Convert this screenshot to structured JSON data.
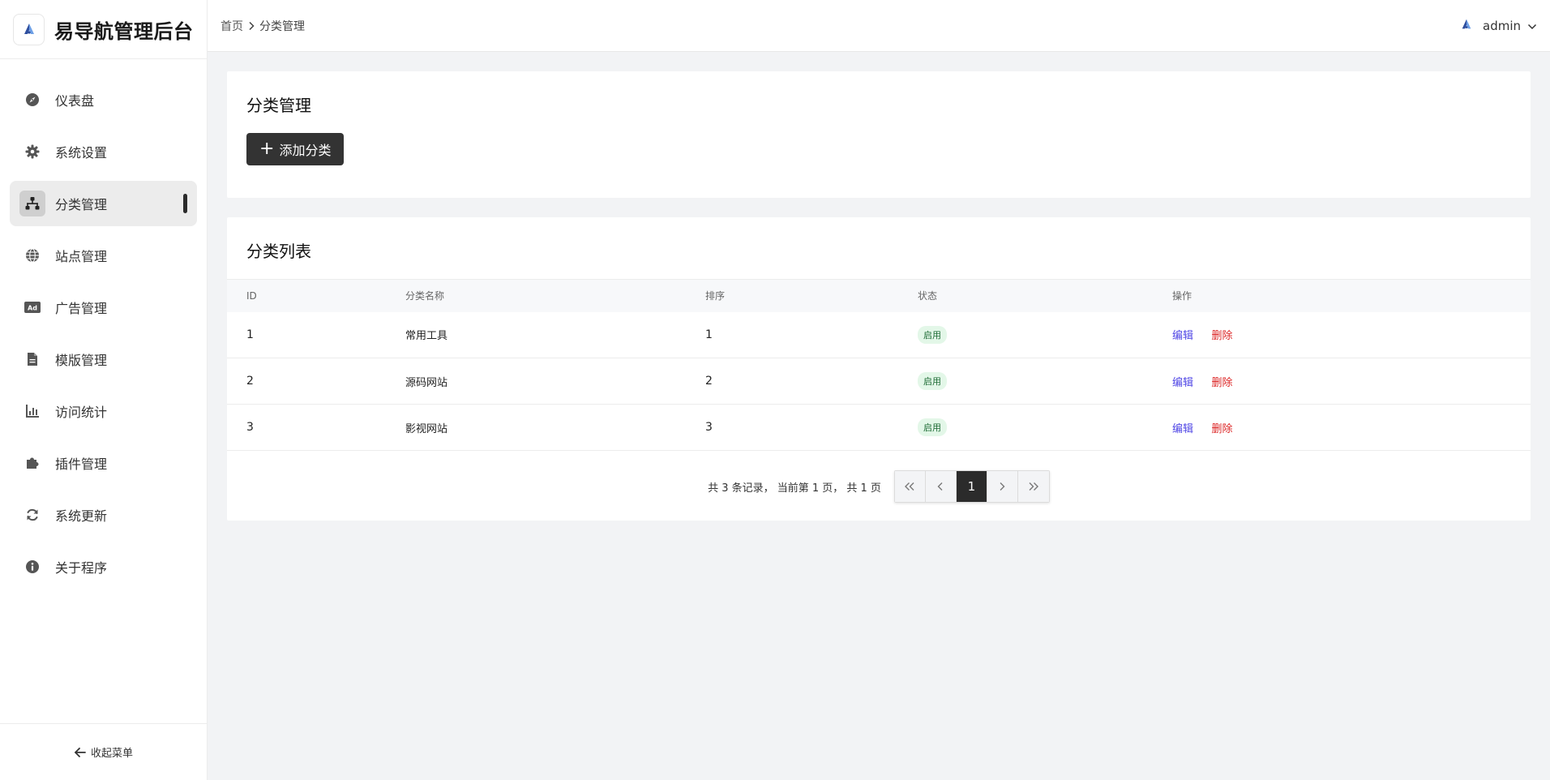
{
  "sidebar": {
    "title": "易导航管理后台",
    "items": [
      {
        "label": "仪表盘",
        "icon": "compass-icon"
      },
      {
        "label": "系统设置",
        "icon": "gear-icon"
      },
      {
        "label": "分类管理",
        "icon": "sitemap-icon",
        "active": true
      },
      {
        "label": "站点管理",
        "icon": "globe-icon"
      },
      {
        "label": "广告管理",
        "icon": "ad-icon"
      },
      {
        "label": "模版管理",
        "icon": "file-icon"
      },
      {
        "label": "访问统计",
        "icon": "chart-icon"
      },
      {
        "label": "插件管理",
        "icon": "puzzle-icon"
      },
      {
        "label": "系统更新",
        "icon": "refresh-icon"
      },
      {
        "label": "关于程序",
        "icon": "info-icon"
      }
    ],
    "collapse_label": "收起菜单"
  },
  "topbar": {
    "breadcrumb": [
      "首页",
      "分类管理"
    ],
    "username": "admin"
  },
  "main": {
    "header_title": "分类管理",
    "add_button_label": "添加分类",
    "list_title": "分类列表",
    "columns": [
      "ID",
      "分类名称",
      "排序",
      "状态",
      "操作"
    ],
    "rows": [
      {
        "id": "1",
        "name": "常用工具",
        "sort": "1",
        "status": "启用"
      },
      {
        "id": "2",
        "name": "源码网站",
        "sort": "2",
        "status": "启用"
      },
      {
        "id": "3",
        "name": "影视网站",
        "sort": "3",
        "status": "启用"
      }
    ],
    "actions": {
      "edit": "编辑",
      "delete": "删除"
    },
    "pagination": {
      "summary": "共 3 条记录， 当前第 1 页， 共 1 页",
      "current_page": "1"
    }
  },
  "colors": {
    "accent_dark": "#333333",
    "edit_link": "#4f46e5",
    "delete_link": "#dc2626",
    "status_badge_bg": "#e3f7e8"
  }
}
